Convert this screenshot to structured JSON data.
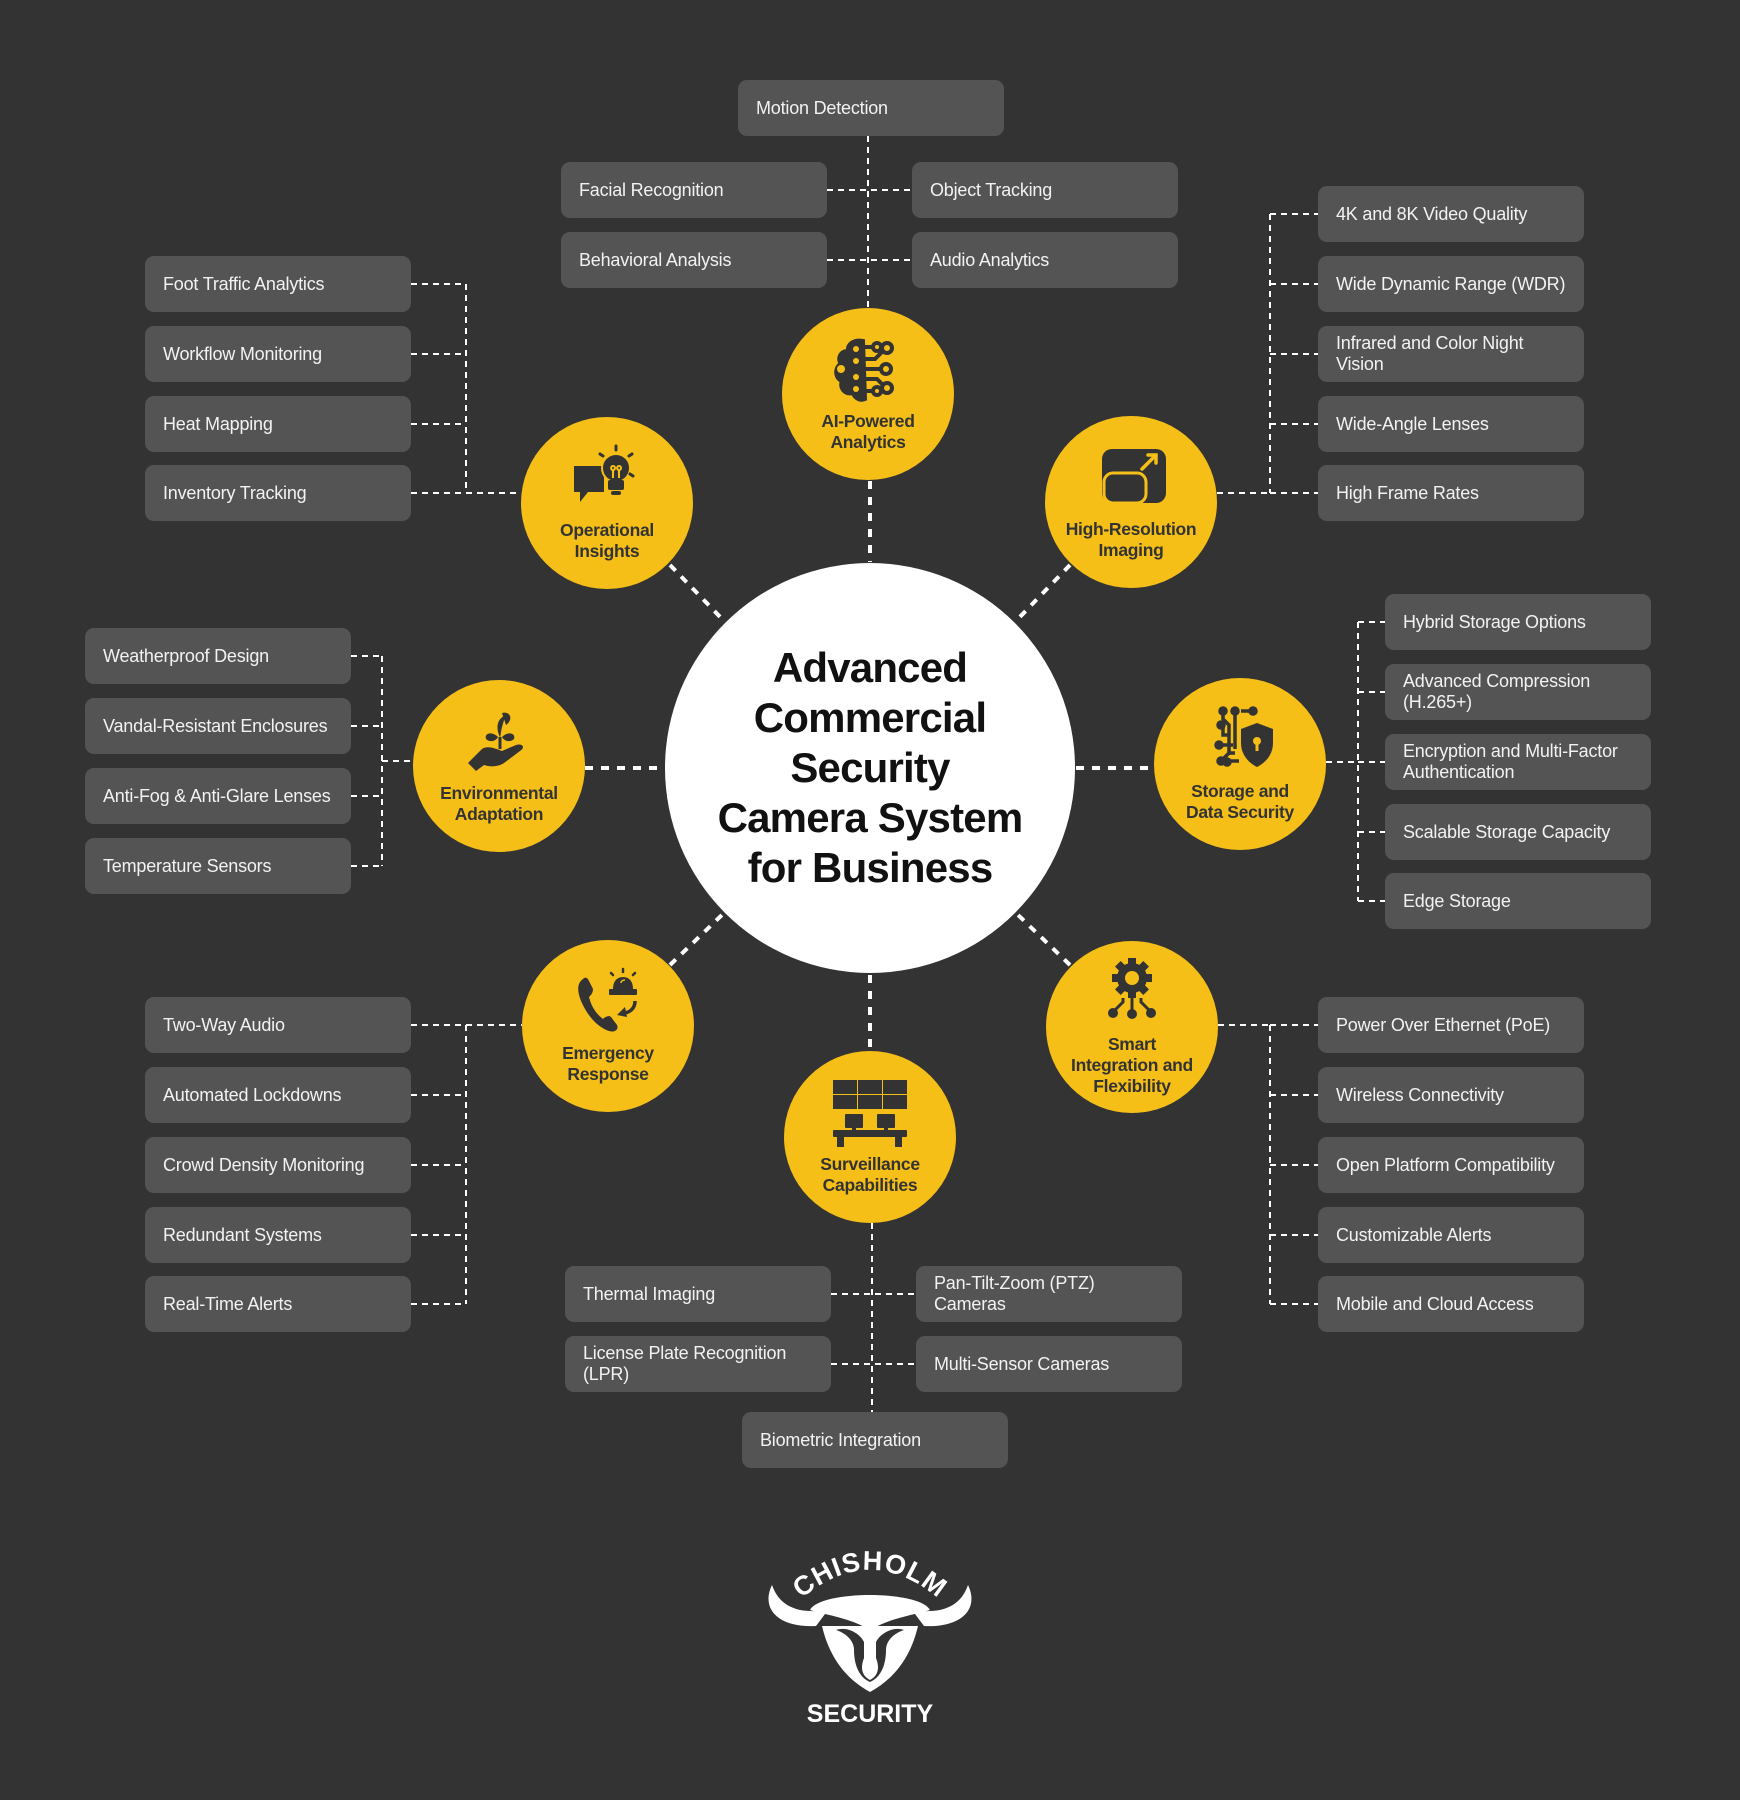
{
  "title": "Advanced\nCommercial\nSecurity\nCamera System\nfor Business",
  "colors": {
    "background": "#333333",
    "hub": "#f5bf18",
    "box": "#545454",
    "center": "#ffffff",
    "connector": "#ffffff"
  },
  "hubs": [
    {
      "id": "ai",
      "label": "AI-Powered\nAnalytics",
      "icon": "brain-circuit-icon",
      "items": [
        "Motion Detection",
        "Facial Recognition",
        "Object Tracking",
        "Behavioral Analysis",
        "Audio Analytics"
      ]
    },
    {
      "id": "operational",
      "label": "Operational\nInsights",
      "icon": "lightbulb-chat-icon",
      "items": [
        "Foot Traffic Analytics",
        "Workflow Monitoring",
        "Heat Mapping",
        "Inventory Tracking"
      ]
    },
    {
      "id": "highres",
      "label": "High-Resolution\nImaging",
      "icon": "expand-screen-icon",
      "items": [
        "4K and 8K Video Quality",
        "Wide Dynamic Range (WDR)",
        "Infrared and Color Night Vision",
        "Wide-Angle Lenses",
        "High Frame Rates"
      ]
    },
    {
      "id": "environmental",
      "label": "Environmental\nAdaptation",
      "icon": "hand-plant-icon",
      "items": [
        "Weatherproof Design",
        "Vandal-Resistant Enclosures",
        "Anti-Fog & Anti-Glare Lenses",
        "Temperature Sensors"
      ]
    },
    {
      "id": "storage",
      "label": "Storage and\nData Security",
      "icon": "circuit-shield-lock-icon",
      "items": [
        "Hybrid Storage Options",
        "Advanced Compression (H.265+)",
        "Encryption and Multi-Factor Authentication",
        "Scalable Storage Capacity",
        "Edge Storage"
      ]
    },
    {
      "id": "emergency",
      "label": "Emergency\nResponse",
      "icon": "phone-siren-icon",
      "items": [
        "Two-Way Audio",
        "Automated Lockdowns",
        "Crowd Density Monitoring",
        "Redundant Systems",
        "Real-Time Alerts"
      ]
    },
    {
      "id": "smart",
      "label": "Smart\nIntegration and\nFlexibility",
      "icon": "gear-network-icon",
      "items": [
        "Power Over Ethernet (PoE)",
        "Wireless Connectivity",
        "Open Platform Compatibility",
        "Customizable Alerts",
        "Mobile and Cloud Access"
      ]
    },
    {
      "id": "surveillance",
      "label": "Surveillance\nCapabilities",
      "icon": "video-wall-icon",
      "items": [
        "Thermal Imaging",
        "Pan-Tilt-Zoom (PTZ) Cameras",
        "License Plate Recognition (LPR)",
        "Multi-Sensor Cameras",
        "Biometric Integration"
      ]
    }
  ],
  "logo": {
    "top_text": "CHISHOLM",
    "bottom_text": "SECURITY"
  }
}
